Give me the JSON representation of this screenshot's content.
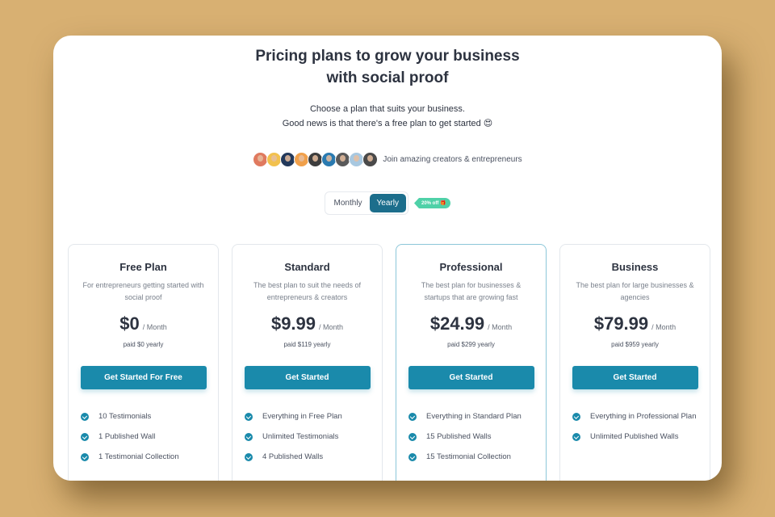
{
  "header": {
    "title_line1": "Pricing plans to grow your business",
    "title_line2": "with social proof",
    "subtitle_line1": "Choose a plan that suits your business.",
    "subtitle_line2": "Good news is that there's a free plan to get started",
    "subtitle_emoji": "😍"
  },
  "social_proof": {
    "avatar_count": 9,
    "avatar_colors": [
      "#e07a5f",
      "#f2c14e",
      "#23395b",
      "#f0a04b",
      "#3d3d3d",
      "#2a7ab0",
      "#5a5a5a",
      "#a8c8e0",
      "#4a4a4a"
    ],
    "text": "Join amazing creators & entrepreneurs"
  },
  "billing_toggle": {
    "options": [
      "Monthly",
      "Yearly"
    ],
    "selected": "Yearly",
    "discount_badge": "20% off 🎁"
  },
  "colors": {
    "accent": "#1a8aab",
    "toggle_active": "#1c6e8c",
    "badge": "#4fd1a8",
    "background": "#d8b072"
  },
  "plans": [
    {
      "name": "Free Plan",
      "description": "For entrepreneurs getting started with social proof",
      "price": "$0",
      "period": "/ Month",
      "paid_note": "paid $0 yearly",
      "cta": "Get Started For Free",
      "featured": false,
      "features": [
        "10 Testimonials",
        "1 Published Wall",
        "1 Testimonial Collection"
      ]
    },
    {
      "name": "Standard",
      "description": "The best plan to suit the needs of entrepreneurs & creators",
      "price": "$9.99",
      "period": "/ Month",
      "paid_note": "paid $119 yearly",
      "cta": "Get Started",
      "featured": false,
      "features": [
        "Everything in Free Plan",
        "Unlimited Testimonials",
        "4 Published Walls"
      ]
    },
    {
      "name": "Professional",
      "description": "The best plan for businesses & startups that are growing fast",
      "price": "$24.99",
      "period": "/ Month",
      "paid_note": "paid $299 yearly",
      "cta": "Get Started",
      "featured": true,
      "features": [
        "Everything in Standard Plan",
        "15 Published Walls",
        "15 Testimonial Collection"
      ]
    },
    {
      "name": "Business",
      "description": "The best plan for large businesses & agencies",
      "price": "$79.99",
      "period": "/ Month",
      "paid_note": "paid $959 yearly",
      "cta": "Get Started",
      "featured": false,
      "features": [
        "Everything in Professional Plan",
        "Unlimited Published Walls"
      ]
    }
  ]
}
